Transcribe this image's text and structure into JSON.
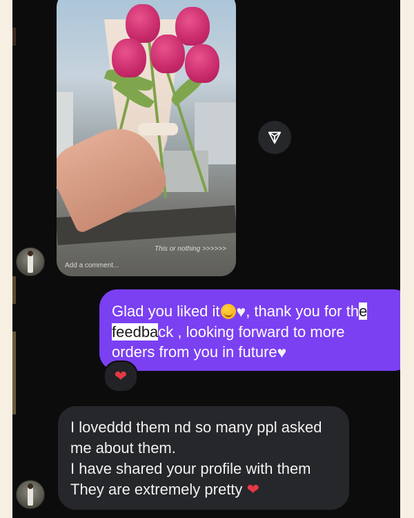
{
  "story": {
    "watermark": "This or nothing >>>>>>",
    "comment_placeholder": "Add a comment..."
  },
  "share_button": {
    "icon": "send-icon"
  },
  "sent_message": {
    "part1": "Glad you liked it",
    "part2": ", thank you for th",
    "hl1": "e",
    "hl2": "feedba",
    "part3": "ck , looking forward to more",
    "part4": "orders from you in future",
    "emoji_smile": "smiling-face-emoji",
    "emoji_heart": "white-heart-emoji"
  },
  "reaction": {
    "emoji": "❤",
    "icon": "red-heart-icon"
  },
  "received_message": {
    "line1": "I loveddd them nd so many ppl asked",
    "line2": "me about them.",
    "line3": "I have shared your profile with them",
    "line4": "They are extremely pretty",
    "heart": "❤"
  },
  "colors": {
    "sent_bubble": "#7b40f2",
    "received_bubble": "#26272b",
    "background": "#0c0c0d",
    "page_border": "#f8efe3"
  }
}
